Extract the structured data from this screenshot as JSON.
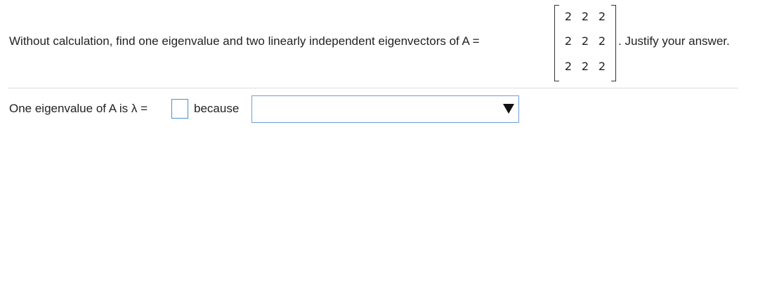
{
  "question": {
    "prompt": "Without calculation, find one eigenvalue and two linearly independent eigenvectors of A =",
    "matrix": [
      [
        "2",
        "2",
        "2"
      ],
      [
        "2",
        "2",
        "2"
      ],
      [
        "2",
        "2",
        "2"
      ]
    ],
    "suffix": ". Justify your answer."
  },
  "answer": {
    "eigenvalue_label": "One eigenvalue of A is λ =",
    "eigenvalue_value": "",
    "because_label": "because",
    "reason_selected": "",
    "dropdown_icon": "triangle-down-icon"
  }
}
